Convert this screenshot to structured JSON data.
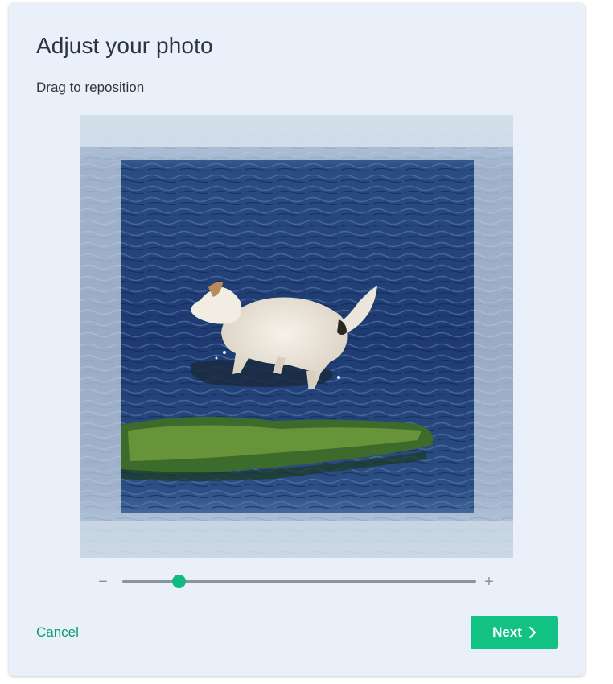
{
  "dialog": {
    "title": "Adjust your photo",
    "subtitle": "Drag to reposition"
  },
  "zoom": {
    "minus_label": "−",
    "plus_label": "+",
    "value_fraction": 0.16
  },
  "actions": {
    "cancel_label": "Cancel",
    "next_label": "Next"
  },
  "colors": {
    "accent": "#12c184",
    "accent_text": "#0f9a6c",
    "background": "#e9f0f9",
    "water": "#1f3f78"
  },
  "icons": {
    "next_icon": "chevron-right-icon"
  }
}
